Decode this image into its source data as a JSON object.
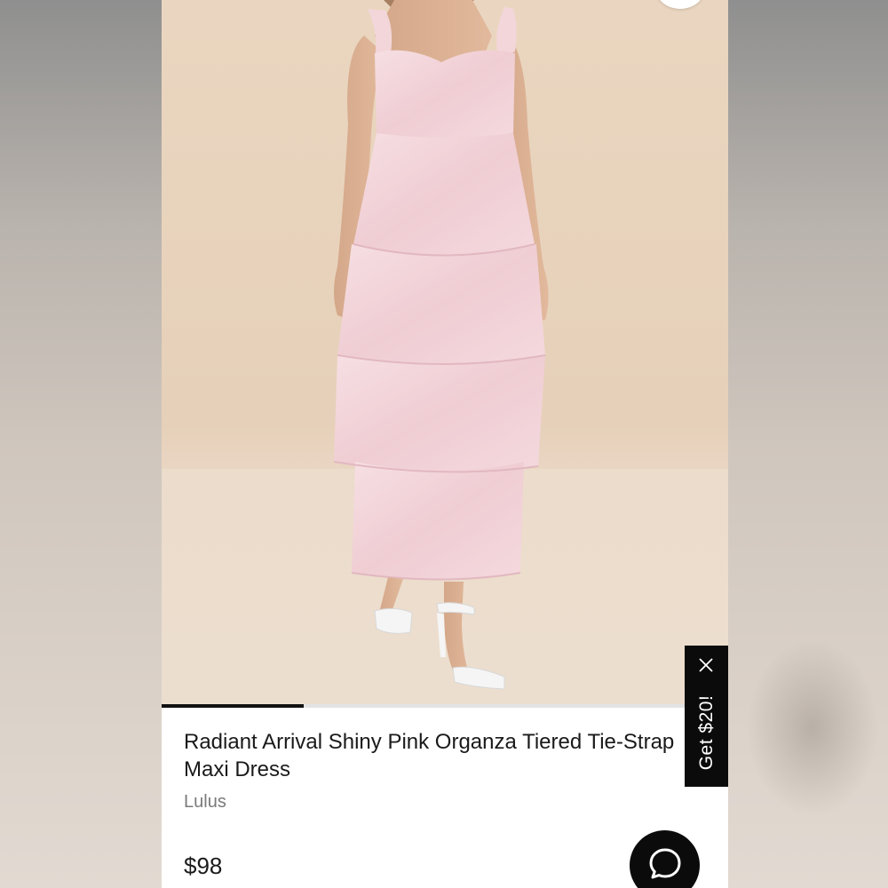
{
  "product": {
    "title": "Radiant Arrival Shiny Pink Organza Tiered Tie-Strap Maxi Dress",
    "brand": "Lulus",
    "price": "$98",
    "image_carousel_progress": 0.25
  },
  "promo": {
    "label": "Get $20!",
    "close_icon": "close-icon"
  },
  "chat": {
    "icon": "chat-bubble-icon"
  },
  "colors": {
    "backdrop": "#ead6c0",
    "dress": "#f3d6da",
    "text": "#1a1a1a",
    "muted": "#7a7a7a",
    "dark_button": "#0b0b0b"
  }
}
